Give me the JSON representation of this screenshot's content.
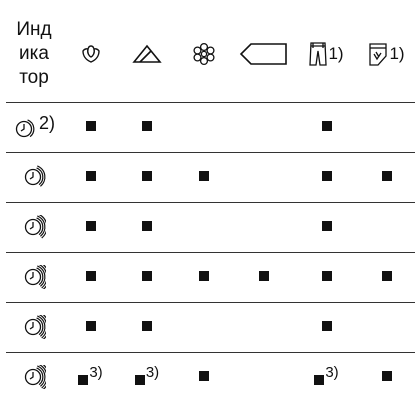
{
  "header": {
    "indicator_line1": "Инд",
    "indicator_line2": "ика",
    "indicator_line3": "тор",
    "columns": [
      {
        "icon": "cotton-flower-icon",
        "note": ""
      },
      {
        "icon": "synthetics-triangle-icon",
        "note": ""
      },
      {
        "icon": "delicates-flower-icon",
        "note": ""
      },
      {
        "icon": "wool-label-icon",
        "note": ""
      },
      {
        "icon": "jeans-icon",
        "note": "1)"
      },
      {
        "icon": "shirt-icon",
        "note": "1)"
      }
    ]
  },
  "rows": [
    {
      "icon": "time-indicator-1-icon",
      "note": "2)",
      "marks": [
        true,
        true,
        false,
        false,
        true,
        false
      ],
      "mark_notes": [
        "",
        "",
        "",
        "",
        "",
        ""
      ]
    },
    {
      "icon": "time-indicator-2-icon",
      "note": "",
      "marks": [
        true,
        true,
        true,
        false,
        true,
        true
      ],
      "mark_notes": [
        "",
        "",
        "",
        "",
        "",
        ""
      ]
    },
    {
      "icon": "time-indicator-3-icon",
      "note": "",
      "marks": [
        true,
        true,
        false,
        false,
        true,
        false
      ],
      "mark_notes": [
        "",
        "",
        "",
        "",
        "",
        ""
      ]
    },
    {
      "icon": "time-indicator-4-icon",
      "note": "",
      "marks": [
        true,
        true,
        true,
        true,
        true,
        true
      ],
      "mark_notes": [
        "",
        "",
        "",
        "",
        "",
        ""
      ]
    },
    {
      "icon": "time-indicator-5-icon",
      "note": "",
      "marks": [
        true,
        true,
        false,
        false,
        true,
        false
      ],
      "mark_notes": [
        "",
        "",
        "",
        "",
        "",
        ""
      ]
    },
    {
      "icon": "time-indicator-6-icon",
      "note": "",
      "marks": [
        true,
        true,
        true,
        false,
        true,
        true
      ],
      "mark_notes": [
        "3)",
        "3)",
        "",
        "",
        "3)",
        ""
      ]
    }
  ]
}
